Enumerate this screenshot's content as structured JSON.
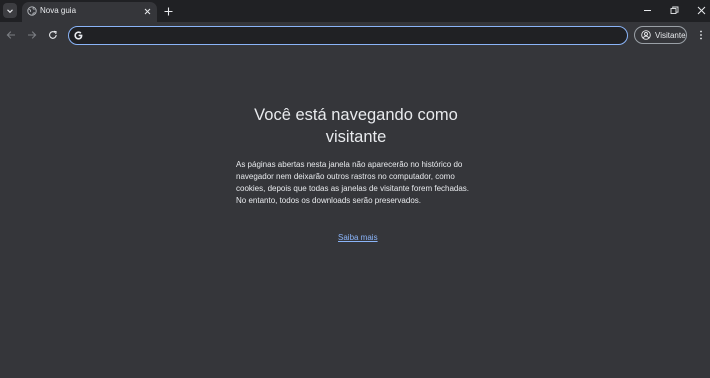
{
  "tabstrip": {
    "tab_search_icon": "chevron-down-icon",
    "tabs": [
      {
        "title": "Nova guia",
        "favicon": "globe-icon",
        "close_icon": "close-icon",
        "active": true
      }
    ],
    "new_tab_icon": "plus-icon",
    "window_controls": [
      "minimize-icon",
      "restore-icon",
      "close-icon"
    ]
  },
  "toolbar": {
    "back_icon": "arrow-left-icon",
    "forward_icon": "arrow-right-icon",
    "reload_icon": "reload-icon",
    "omnibox": {
      "value": "",
      "placeholder": "",
      "icon": "google-g-icon"
    },
    "profile": {
      "label": "Visitante",
      "icon": "user-circle-icon"
    },
    "menu_icon": "more-vertical-icon"
  },
  "guest_page": {
    "heading": "Você está navegando como visitante",
    "description": "As páginas abertas nesta janela não aparecerão no histórico do navegador nem deixarão outros rastros no computador, como cookies, depois que todas as janelas de visitante forem fechadas. No entanto, todos os downloads serão preservados.",
    "learn_more": "Saiba mais"
  },
  "colors": {
    "tabstrip_bg": "#202124",
    "page_bg": "#35363a",
    "focus_ring": "#8ab4f8",
    "link": "#8ab4f8",
    "text": "#e8eaed"
  }
}
